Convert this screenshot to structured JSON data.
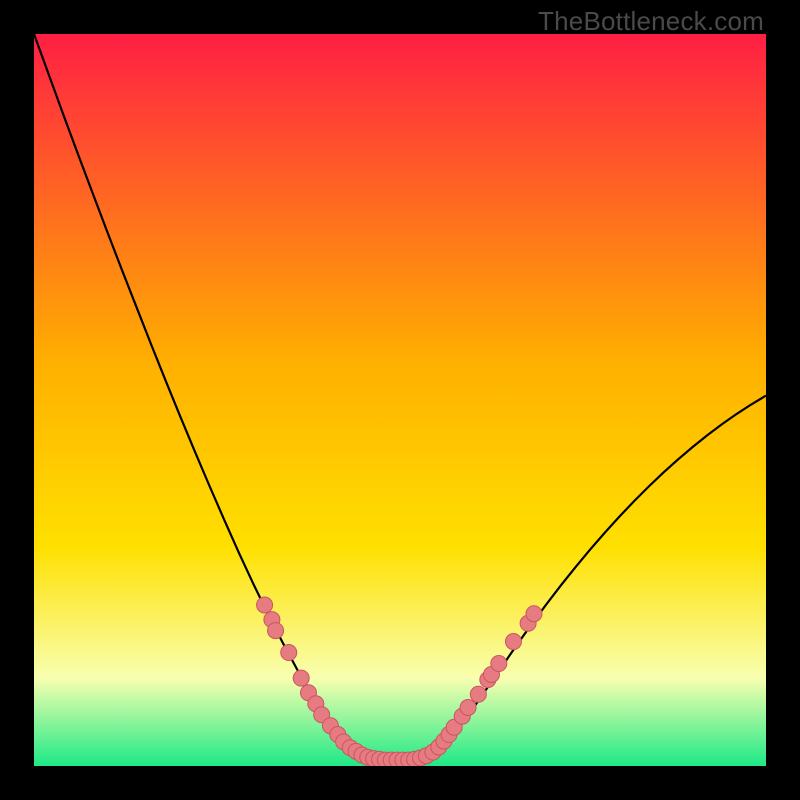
{
  "watermark": "TheBottleneck.com",
  "colors": {
    "frame": "#000000",
    "watermark": "#4a4a4a",
    "gradient_top": "#ff1f44",
    "gradient_mid": "#ffd400",
    "gradient_low": "#f8ffb0",
    "gradient_bottom": "#1de986",
    "curve": "#000000",
    "marker_fill": "#e77b82",
    "marker_stroke": "#c9565f"
  },
  "chart_data": {
    "type": "line",
    "title": "",
    "xlabel": "",
    "ylabel": "",
    "xlim": [
      0,
      100
    ],
    "ylim": [
      0,
      100
    ],
    "series": [
      {
        "name": "bottleneck-curve",
        "x": [
          0,
          2,
          4,
          6,
          8,
          10,
          12,
          14,
          16,
          18,
          20,
          22,
          24,
          26,
          28,
          30,
          32,
          34,
          36,
          38,
          40,
          42,
          43,
          44,
          45,
          46,
          47,
          48,
          49,
          50,
          52,
          54,
          56,
          58,
          60,
          62,
          64,
          66,
          68,
          70,
          72,
          74,
          76,
          78,
          80,
          82,
          84,
          86,
          88,
          90,
          92,
          94,
          96,
          98,
          100
        ],
        "y": [
          100,
          94.5,
          89,
          83.6,
          78.3,
          73,
          67.8,
          62.7,
          57.6,
          52.6,
          47.7,
          42.9,
          38.2,
          33.6,
          29.1,
          24.8,
          20.7,
          16.8,
          13.1,
          9.7,
          6.6,
          4.0,
          3.0,
          2.2,
          1.5,
          1.0,
          0.8,
          0.8,
          0.8,
          0.8,
          0.9,
          1.5,
          3.0,
          5.2,
          7.9,
          10.8,
          13.7,
          16.6,
          19.4,
          22.1,
          24.7,
          27.2,
          29.6,
          31.9,
          34.1,
          36.2,
          38.2,
          40.1,
          41.9,
          43.6,
          45.2,
          46.7,
          48.1,
          49.4,
          50.6
        ]
      }
    ],
    "markers": {
      "name": "data-points",
      "points": [
        {
          "x": 31.5,
          "y": 22.0
        },
        {
          "x": 32.5,
          "y": 20.0
        },
        {
          "x": 33.0,
          "y": 18.5
        },
        {
          "x": 34.8,
          "y": 15.5
        },
        {
          "x": 36.5,
          "y": 12.0
        },
        {
          "x": 37.5,
          "y": 10.0
        },
        {
          "x": 38.5,
          "y": 8.5
        },
        {
          "x": 39.3,
          "y": 7.0
        },
        {
          "x": 40.5,
          "y": 5.5
        },
        {
          "x": 41.5,
          "y": 4.3
        },
        {
          "x": 42.3,
          "y": 3.3
        },
        {
          "x": 43.2,
          "y": 2.5
        },
        {
          "x": 44.0,
          "y": 2.0
        },
        {
          "x": 44.8,
          "y": 1.5
        },
        {
          "x": 45.6,
          "y": 1.2
        },
        {
          "x": 46.4,
          "y": 1.0
        },
        {
          "x": 47.2,
          "y": 0.9
        },
        {
          "x": 48.0,
          "y": 0.8
        },
        {
          "x": 48.8,
          "y": 0.8
        },
        {
          "x": 49.6,
          "y": 0.8
        },
        {
          "x": 50.4,
          "y": 0.8
        },
        {
          "x": 51.2,
          "y": 0.8
        },
        {
          "x": 52.0,
          "y": 0.9
        },
        {
          "x": 52.8,
          "y": 1.1
        },
        {
          "x": 53.6,
          "y": 1.4
        },
        {
          "x": 54.5,
          "y": 1.9
        },
        {
          "x": 55.3,
          "y": 2.6
        },
        {
          "x": 56.0,
          "y": 3.4
        },
        {
          "x": 56.7,
          "y": 4.3
        },
        {
          "x": 57.4,
          "y": 5.3
        },
        {
          "x": 58.5,
          "y": 6.8
        },
        {
          "x": 59.3,
          "y": 8.0
        },
        {
          "x": 60.7,
          "y": 9.8
        },
        {
          "x": 62.0,
          "y": 11.8
        },
        {
          "x": 62.5,
          "y": 12.5
        },
        {
          "x": 63.5,
          "y": 14.0
        },
        {
          "x": 65.5,
          "y": 17.0
        },
        {
          "x": 67.5,
          "y": 19.5
        },
        {
          "x": 68.3,
          "y": 20.8
        }
      ]
    }
  }
}
